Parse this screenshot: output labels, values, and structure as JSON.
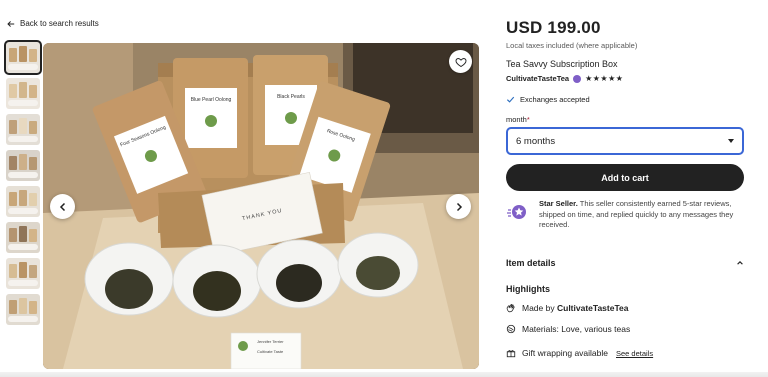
{
  "nav": {
    "back_label": "Back to search results"
  },
  "gallery": {
    "thumbnail_count": 8,
    "favorite_icon": "heart-icon",
    "prev_icon": "chevron-left-icon",
    "next_icon": "chevron-right-icon",
    "photo_texts": {
      "bag1": "Four Seasons Oolong",
      "bag2": "Blue Pearl Oolong",
      "bag3": "Black Pearls",
      "bag4": "Rose Oolong",
      "card": "THANK YOU",
      "bizcard": "Jennifer Terrier",
      "bizcard_sub": "Cultivate Taste"
    }
  },
  "product": {
    "price": "USD 199.00",
    "tax_note": "Local taxes included (where applicable)",
    "title": "Tea Savvy Subscription Box",
    "shop_name": "CultivateTasteTea",
    "rating_stars": "★★★★★",
    "exchanges": "Exchanges accepted"
  },
  "variation": {
    "label": "month",
    "required_mark": "*",
    "selected": "6 months"
  },
  "actions": {
    "add_to_cart": "Add to cart"
  },
  "seller": {
    "badge_title": "Star Seller.",
    "description": "This seller consistently earned 5-star reviews, shipped on time, and replied quickly to any messages they received."
  },
  "details": {
    "section_title": "Item details",
    "highlights_title": "Highlights",
    "made_by_prefix": "Made by",
    "made_by_shop": "CultivateTasteTea",
    "materials": "Materials: Love, various teas",
    "gift_wrap": "Gift wrapping available",
    "see_details": "See details"
  },
  "colors": {
    "accent_blue": "#3b67d6",
    "star_seller_purple": "#7f5fc7",
    "cta_dark": "#222222",
    "required_red": "#a61a2e"
  }
}
